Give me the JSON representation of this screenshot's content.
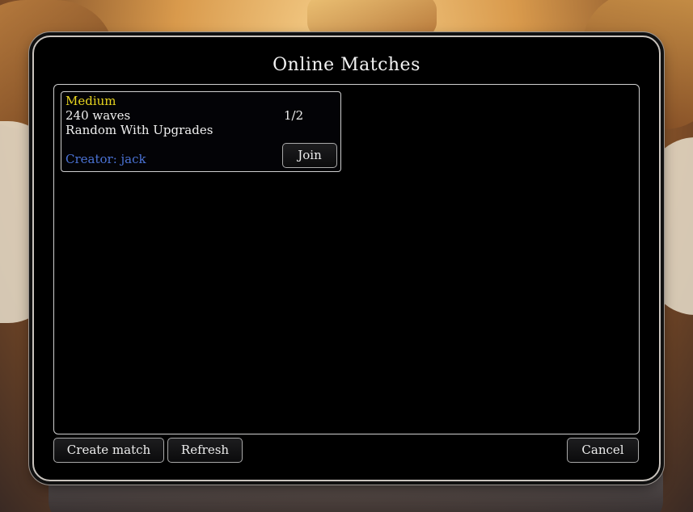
{
  "dialog": {
    "title": "Online Matches"
  },
  "matches": [
    {
      "difficulty": "Medium",
      "waves": "240 waves",
      "mode": "Random With Upgrades",
      "players": "1/2",
      "creator": "Creator: jack",
      "join_label": "Join"
    }
  ],
  "footer": {
    "create_label": "Create match",
    "refresh_label": "Refresh",
    "cancel_label": "Cancel"
  },
  "colors": {
    "difficulty_medium": "#e8d51f",
    "creator_text": "#4b73d6",
    "dialog_background": "#000000",
    "frame_border": "#c9c3bd"
  }
}
